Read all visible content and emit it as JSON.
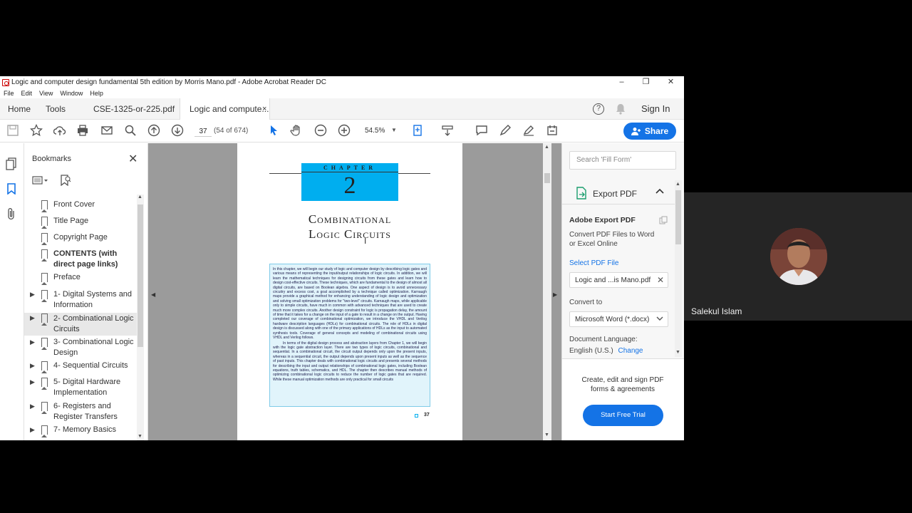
{
  "window": {
    "title": "Logic and computer design fundamental 5th edition by Morris Mano.pdf - Adobe Acrobat Reader DC",
    "controls": [
      "–",
      "❐",
      "✕"
    ]
  },
  "menu": [
    "File",
    "Edit",
    "View",
    "Window",
    "Help"
  ],
  "tabs": {
    "home": "Home",
    "tools": "Tools",
    "doc1": "CSE-1325-or-225.pdf",
    "doc2": "Logic and compute...",
    "doc2_close": "×",
    "help": "?",
    "sign_in": "Sign In"
  },
  "toolbar": {
    "page_current": "37",
    "page_info": "(54 of 674)",
    "zoom": "54.5%",
    "share": "Share"
  },
  "bookmarks": {
    "title": "Bookmarks",
    "items": [
      {
        "label": "Front Cover"
      },
      {
        "label": "Title Page"
      },
      {
        "label": "Copyright Page"
      },
      {
        "label": "CONTENTS (with direct page links)"
      },
      {
        "label": "Preface"
      },
      {
        "label": "1- Digital Systems and Information"
      },
      {
        "label": "2- Combinational Logic Circuits"
      },
      {
        "label": "3- Combinational Logic Design"
      },
      {
        "label": "4- Sequential Circuits"
      },
      {
        "label": "5- Digital Hardware Implementation"
      },
      {
        "label": "6- Registers and Register Transfers"
      },
      {
        "label": "7- Memory Basics"
      }
    ]
  },
  "document": {
    "chapter_word": "CHAPTER",
    "chapter_number": "2",
    "title_line1": "Combinational",
    "title_line2": "Logic Circuits",
    "page_number": "37",
    "intro_p1": "In this chapter, we will begin our study of logic and computer design by describing logic gates and various means of representing the input/output relationships of logic circuits. In addition, we will learn the mathematical techniques for designing circuits from these gates and learn how to design cost-effective circuits. These techniques, which are fundamental to the design of almost all digital circuits, are based on Boolean algebra. One aspect of design is to avoid unnecessary circuitry and excess cost, a goal accomplished by a technique called optimization. Karnaugh maps provide a graphical method for enhancing understanding of logic design and optimization and solving small optimization problems for \"two-level\" circuits. Karnaugh maps, while applicable only to simple circuits, have much in common with advanced techniques that are used to create much more complex circuits. Another design constraint for logic is propagation delay, the amount of time that it takes for a change on the input of a gate to result in a change on the output. Having completed our coverage of combinational optimization, we introduce the VHDL and Verilog hardware description languages (HDLs) for combinational circuits. The role of HDLs in digital design is discussed along with one of the primary applications of HDLs as the input to automated synthesis tools. Coverage of general concepts and modeling of combinational circuits using VHDL and Verilog follows.",
    "intro_p2": "In terms of the digital design process and abstraction layers from Chapter 1, we will begin with the logic gate abstraction layer. There are two types of logic circuits, combinational and sequential. In a combinational circuit, the circuit output depends only upon the present inputs, whereas in a sequential circuit, the output depends upon present inputs as well as the sequence of past inputs. This chapter deals with combinational logic circuits and presents several methods for describing the input and output relationships of combinational logic gates, including Boolean equations, truth tables, schematics, and HDL. The chapter then describes manual methods of optimizing combinational logic circuits to reduce the number of logic gates that are required. While these manual optimization methods are only practical for small circuits"
  },
  "right_panel": {
    "search_placeholder": "Search 'Fill Form'",
    "export_label": "Export PDF",
    "adobe_export_title": "Adobe Export PDF",
    "adobe_export_desc": "Convert PDF Files to Word or Excel Online",
    "select_pdf_label": "Select PDF File",
    "selected_file": "Logic and ...is Mano.pdf",
    "convert_to_label": "Convert to",
    "convert_to_value": "Microsoft Word (*.docx)",
    "doc_lang_label": "Document Language:",
    "doc_lang_value": "English (U.S.)",
    "change_link": "Change",
    "promo_text": "Create, edit and sign PDF forms & agreements",
    "trial_button": "Start Free Trial"
  },
  "meeting": {
    "attendee_name": "Salekul Islam"
  },
  "colors": {
    "accent": "#1473e6",
    "chapter_box": "#00aeef",
    "link": "#1473e6"
  }
}
